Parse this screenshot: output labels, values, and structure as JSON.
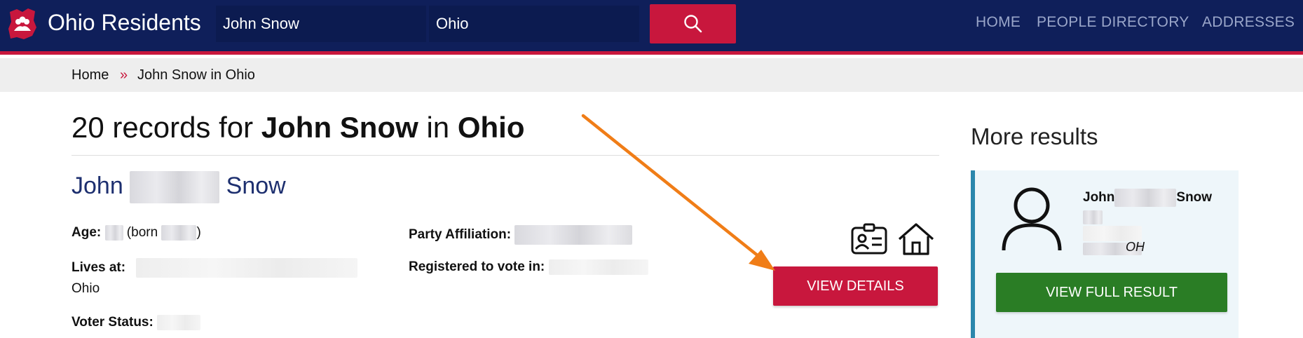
{
  "header": {
    "brand": "Ohio Residents",
    "name_value": "John Snow",
    "state_value": "Ohio",
    "nav": [
      "HOME",
      "PEOPLE DIRECTORY",
      "ADDRESSES"
    ],
    "colors": {
      "navbar": "#0f1f5a",
      "accent": "#c8173d"
    }
  },
  "breadcrumb": {
    "home": "Home",
    "separator": "»",
    "current": "John Snow in Ohio"
  },
  "main": {
    "heading_count": "20 records for ",
    "heading_name": "John Snow",
    "heading_in": " in ",
    "heading_state": "Ohio",
    "record": {
      "first_name": "John",
      "last_name": "Snow",
      "age_label": "Age:",
      "born_prefix": "(born ",
      "born_suffix": ")",
      "lives_label": "Lives at:",
      "lives_state": "Ohio",
      "voter_status_label": "Voter Status:",
      "party_label": "Party Affiliation:",
      "registered_label": "Registered to vote in:",
      "view_details": "VIEW DETAILS"
    }
  },
  "sidebar": {
    "title": "More results",
    "card": {
      "first_name": "John",
      "last_name": "Snow",
      "state": "OH",
      "view_full": "VIEW FULL RESULT"
    }
  },
  "icons": [
    "ohio-logo-icon",
    "search-icon",
    "id-card-icon",
    "house-icon",
    "person-icon",
    "annotation-arrow"
  ]
}
